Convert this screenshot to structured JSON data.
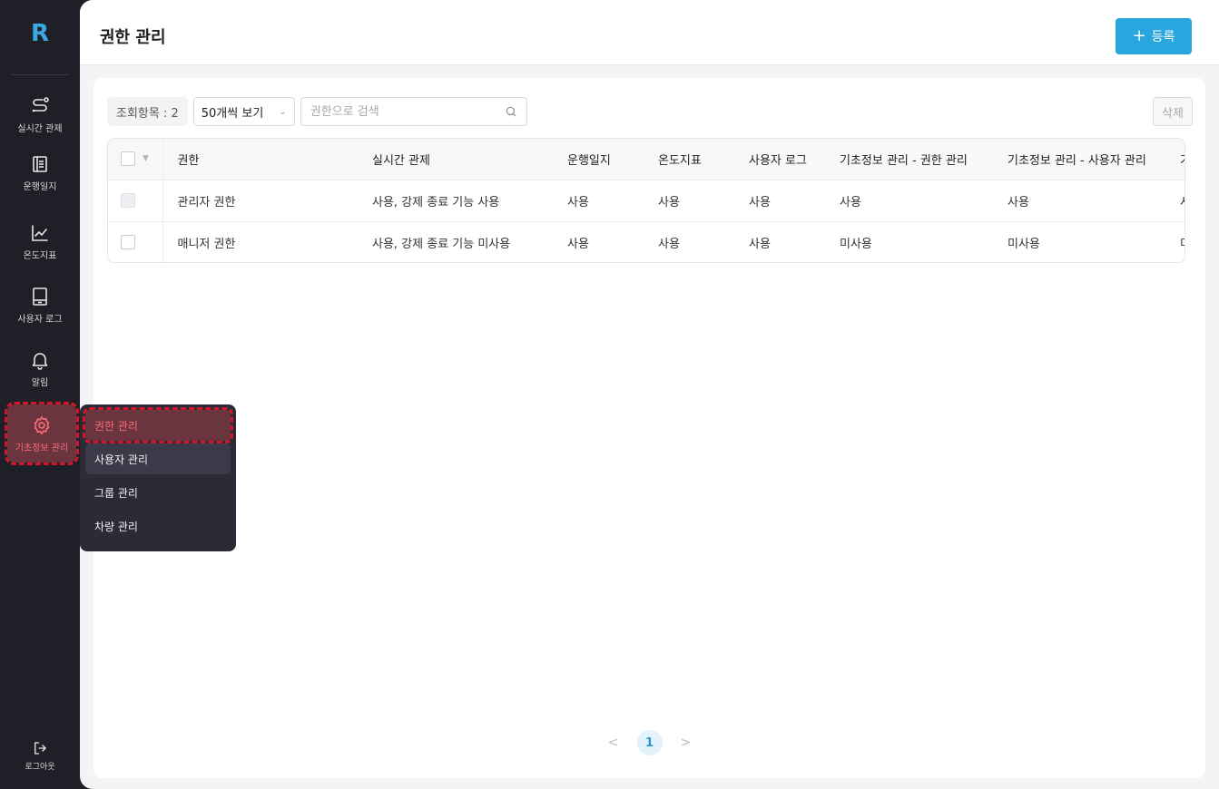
{
  "app": {
    "logo_text": "R"
  },
  "sidebar": {
    "items": [
      {
        "label": "실시간 관제",
        "icon": "route-icon"
      },
      {
        "label": "운행일지",
        "icon": "document-icon"
      },
      {
        "label": "온도지표",
        "icon": "chart-line-icon"
      },
      {
        "label": "사용자 로그",
        "icon": "tablet-icon"
      },
      {
        "label": "알림",
        "icon": "bell-icon"
      },
      {
        "label": "기초정보 관리",
        "icon": "gear-icon",
        "active": true
      }
    ],
    "logout_label": "로그아웃"
  },
  "submenu": {
    "items": [
      {
        "label": "권한 관리",
        "active": true
      },
      {
        "label": "사용자 관리"
      },
      {
        "label": "그룹 관리"
      },
      {
        "label": "차량 관리"
      }
    ]
  },
  "header": {
    "title": "권한 관리",
    "register_label": "등록",
    "register_icon": "+"
  },
  "toolbar": {
    "count_label": "조회항목 : 2",
    "page_size_selected": "50개씩 보기",
    "search_placeholder": "권한으로 검색",
    "delete_label": "삭제"
  },
  "table": {
    "columns": [
      "권한",
      "실시간 관제",
      "운행일지",
      "온도지표",
      "사용자 로그",
      "기초정보 관리 - 권한 관리",
      "기초정보 관리 - 사용자 관리",
      "기초"
    ],
    "rows": [
      {
        "cells": [
          "관리자 권한",
          "사용, 강제 종료 기능 사용",
          "사용",
          "사용",
          "사용",
          "사용",
          "사용",
          "사용"
        ],
        "disabled": true
      },
      {
        "cells": [
          "매니저 권한",
          "사용, 강제 종료 기능 미사용",
          "사용",
          "사용",
          "사용",
          "미사용",
          "미사용",
          "미사용"
        ],
        "disabled": false
      }
    ]
  },
  "pagination": {
    "current": "1",
    "prev": "<",
    "next": ">"
  },
  "colors": {
    "accent": "#2aa6df",
    "active_highlight": "#ff6b78",
    "sidebar_bg": "#1f1f27"
  }
}
